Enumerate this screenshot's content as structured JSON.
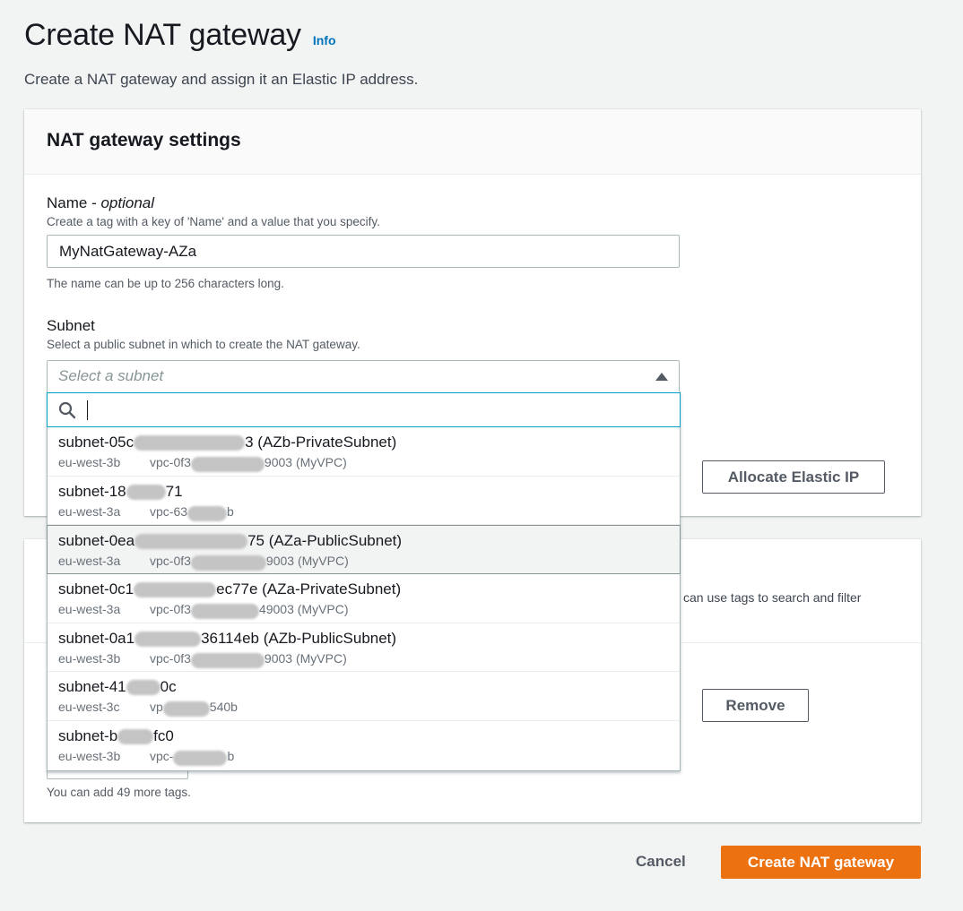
{
  "header": {
    "title": "Create NAT gateway",
    "info": "Info",
    "description": "Create a NAT gateway and assign it an Elastic IP address."
  },
  "settings": {
    "title": "NAT gateway settings",
    "name_label": "Name - ",
    "name_optional": "optional",
    "name_desc": "Create a tag with a key of 'Name' and a value that you specify.",
    "name_value": "MyNatGateway-AZa",
    "name_hint": "The name can be up to 256 characters long.",
    "subnet_label": "Subnet",
    "subnet_desc": "Select a public subnet in which to create the NAT gateway.",
    "subnet_placeholder": "Select a subnet",
    "allocate_button": "Allocate Elastic IP"
  },
  "subnets": [
    {
      "pre": "subnet-05c",
      "post": "3 (AZb-PrivateSubnet)",
      "az": "eu-west-3b",
      "vpc_pre": "vpc-0f3",
      "vpc_post": "9003 (MyVPC)"
    },
    {
      "pre": "subnet-18",
      "post": "71",
      "az": "eu-west-3a",
      "vpc_pre": "vpc-63",
      "vpc_post": "b"
    },
    {
      "pre": "subnet-0ea",
      "post": "75 (AZa-PublicSubnet)",
      "az": "eu-west-3a",
      "vpc_pre": "vpc-0f3",
      "vpc_post": "9003 (MyVPC)"
    },
    {
      "pre": "subnet-0c1",
      "post": "ec77e (AZa-PrivateSubnet)",
      "az": "eu-west-3a",
      "vpc_pre": "vpc-0f3",
      "vpc_post": "49003 (MyVPC)"
    },
    {
      "pre": "subnet-0a1",
      "post": "36114eb (AZb-PublicSubnet)",
      "az": "eu-west-3b",
      "vpc_pre": "vpc-0f3",
      "vpc_post": "9003 (MyVPC)"
    },
    {
      "pre": "subnet-41",
      "post": "0c",
      "az": "eu-west-3c",
      "vpc_pre": "vp",
      "vpc_post": "540b"
    },
    {
      "pre": "subnet-b",
      "post": "fc0",
      "az": "eu-west-3b",
      "vpc_pre": "vpc-",
      "vpc_post": "b"
    }
  ],
  "tags": {
    "desc_fragment": "can use tags to search and filter",
    "remove_button": "Remove",
    "hint": "You can add 49 more tags."
  },
  "footer": {
    "cancel": "Cancel",
    "create": "Create NAT gateway"
  },
  "colors": {
    "primary": "#ec7211",
    "link": "#0073bb",
    "focus": "#00a1c9"
  }
}
